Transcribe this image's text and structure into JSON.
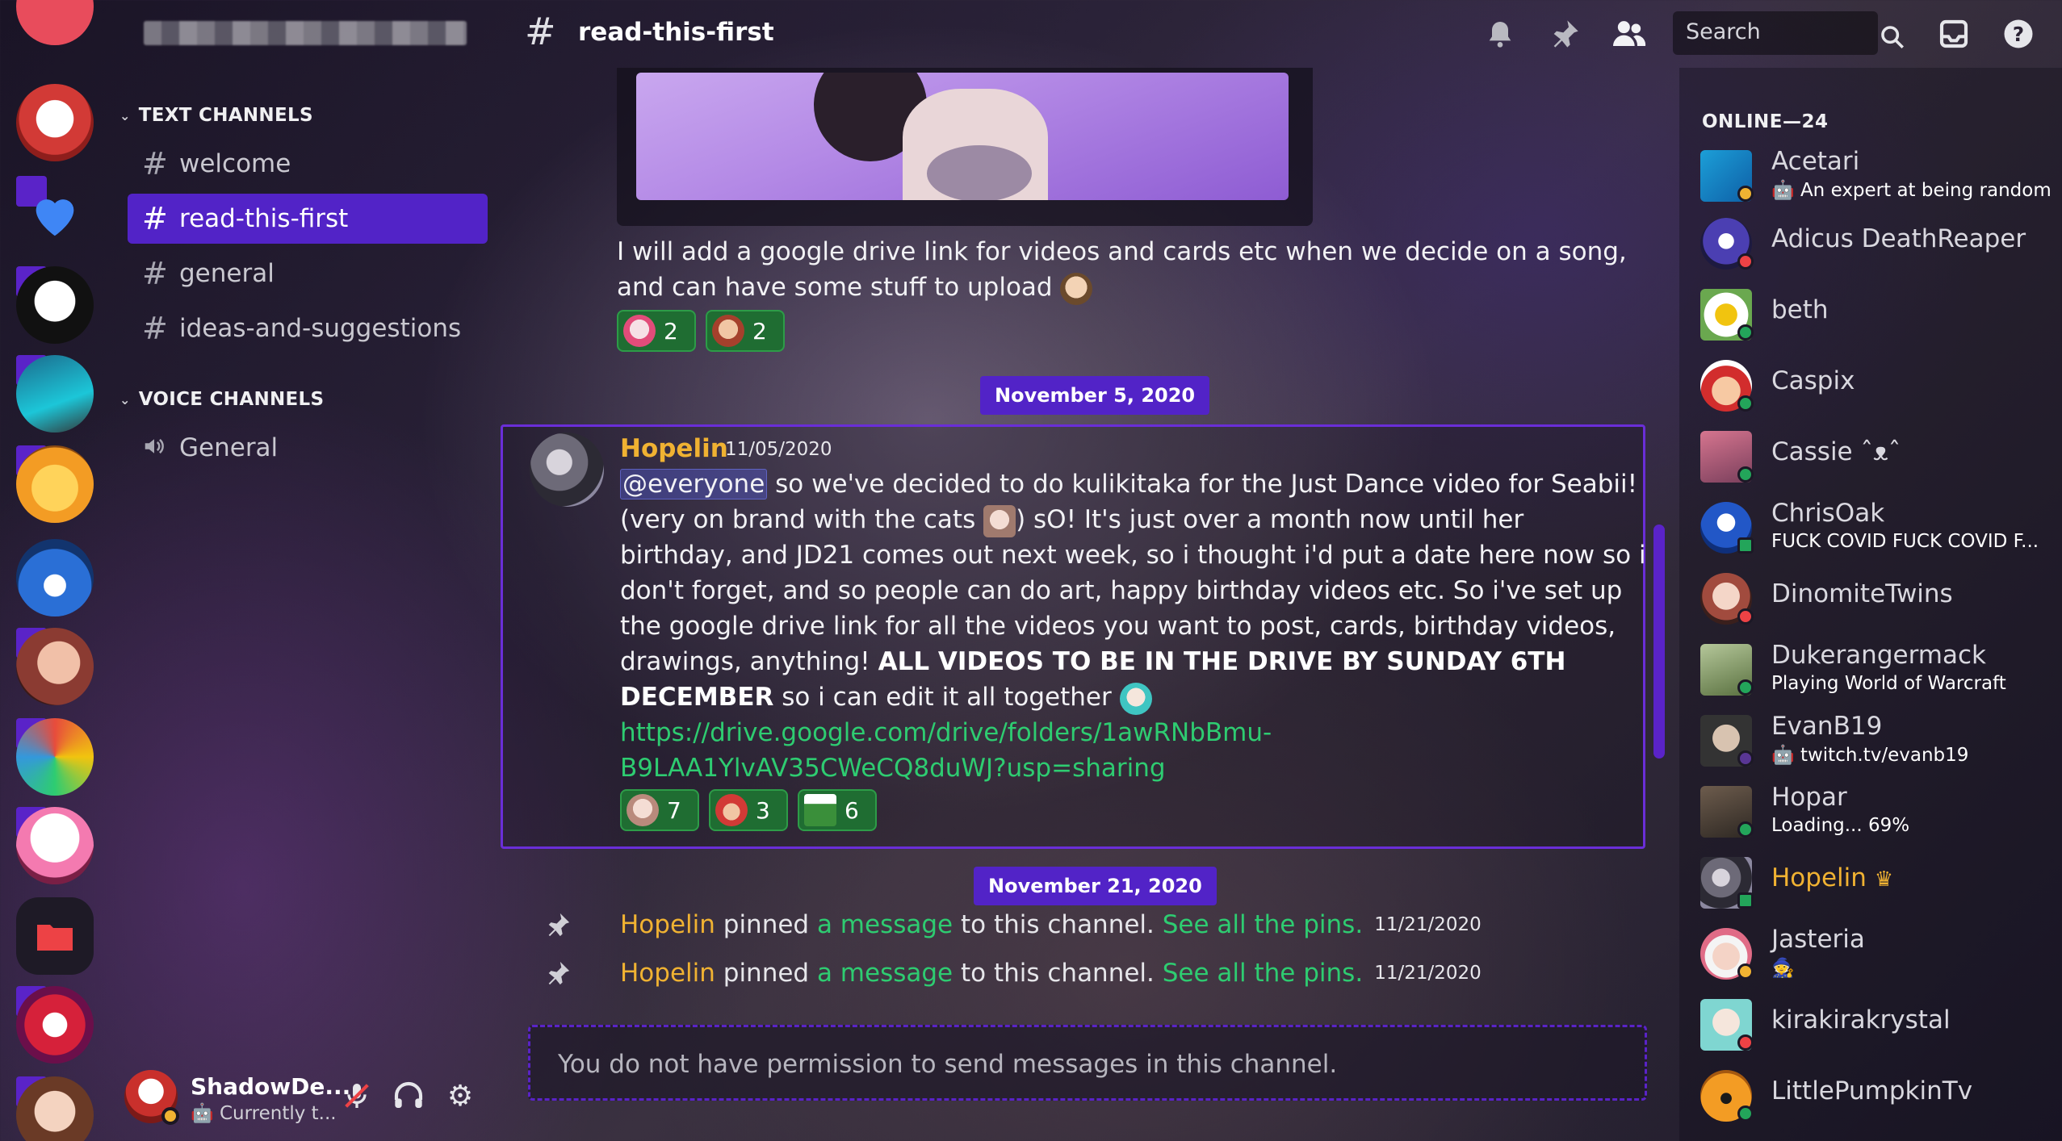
{
  "sidebar": {
    "categories": {
      "text": "TEXT CHANNELS",
      "voice": "VOICE CHANNELS"
    },
    "text_channels": [
      "welcome",
      "read-this-first",
      "general",
      "ideas-and-suggestions"
    ],
    "voice_channels": [
      "General"
    ],
    "active_channel": "read-this-first"
  },
  "user_panel": {
    "name": "ShadowDe...",
    "status": "Currently t..."
  },
  "header": {
    "channel": "read-this-first",
    "search_placeholder": "Search"
  },
  "chat": {
    "prev_message_line1": "I will add a google drive link for videos and cards etc when we decide on a song,",
    "prev_message_line2": "and can have some stuff to upload",
    "prev_reactions": [
      "2",
      "2"
    ],
    "date1": "November 5, 2020",
    "message": {
      "author": "Hopelin",
      "timestamp": "11/05/2020",
      "mention": "@everyone",
      "line1": " so we've decided to do kulikitaka for the Just Dance video for Seabii!",
      "line2a": "(very on brand with the cats ",
      "line2b": ") sO! It's just over a month now until her",
      "line3": "birthday, and JD21 comes out next week, so i thought i'd put a date here now so i",
      "line4": "don't forget, and so people can do art, happy birthday videos etc. So i've set up",
      "line5": "the google drive link for all the videos you want to post, cards, birthday videos,",
      "line6a": "drawings, anything! ",
      "line6b": "ALL VIDEOS TO BE IN THE DRIVE BY SUNDAY 6TH",
      "line7a": "DECEMBER",
      "line7b": " so i can edit it all together",
      "link1": "https://drive.google.com/drive/folders/1awRNbBmu-",
      "link2": "B9LAA1YlvAV35CWeCQ8duWJ?usp=sharing",
      "reactions": [
        "7",
        "3",
        "6"
      ]
    },
    "date2": "November 21, 2020",
    "pins": [
      {
        "author": "Hopelin",
        "pinned": " pinned ",
        "message": "a message",
        "to": " to this channel. ",
        "see": "See all the pins.",
        "time": "11/21/2020"
      },
      {
        "author": "Hopelin",
        "pinned": " pinned ",
        "message": "a message",
        "to": " to this channel. ",
        "see": "See all the pins.",
        "time": "11/21/2020"
      }
    ],
    "no_permission": "You do not have permission to send messages in this channel."
  },
  "members": {
    "header": "ONLINE—24",
    "list": [
      {
        "name": "Acetari",
        "activity": "An expert at being random"
      },
      {
        "name": "Adicus DeathReaper",
        "activity": ""
      },
      {
        "name": "beth",
        "activity": ""
      },
      {
        "name": "Caspix",
        "activity": ""
      },
      {
        "name": "Cassie ˆᴥˆ",
        "activity": ""
      },
      {
        "name": "ChrisOak",
        "activity": "FUCK COVID FUCK COVID F..."
      },
      {
        "name": "DinomiteTwins",
        "activity": ""
      },
      {
        "name": "Dukerangermack",
        "activity": "Playing World of Warcraft"
      },
      {
        "name": "EvanB19",
        "activity": "twitch.tv/evanb19"
      },
      {
        "name": "Hopar",
        "activity": "Loading... 69%"
      },
      {
        "name": "Hopelin",
        "activity": ""
      },
      {
        "name": "Jasteria",
        "activity": ""
      },
      {
        "name": "kirakirakrystal",
        "activity": ""
      },
      {
        "name": "LittlePumpkinTv",
        "activity": ""
      }
    ]
  },
  "colors": {
    "accent": "#5223c7",
    "mention_gold": "#f0b232",
    "link_green": "#2ecc71",
    "reaction_green": "#1f6d32"
  }
}
